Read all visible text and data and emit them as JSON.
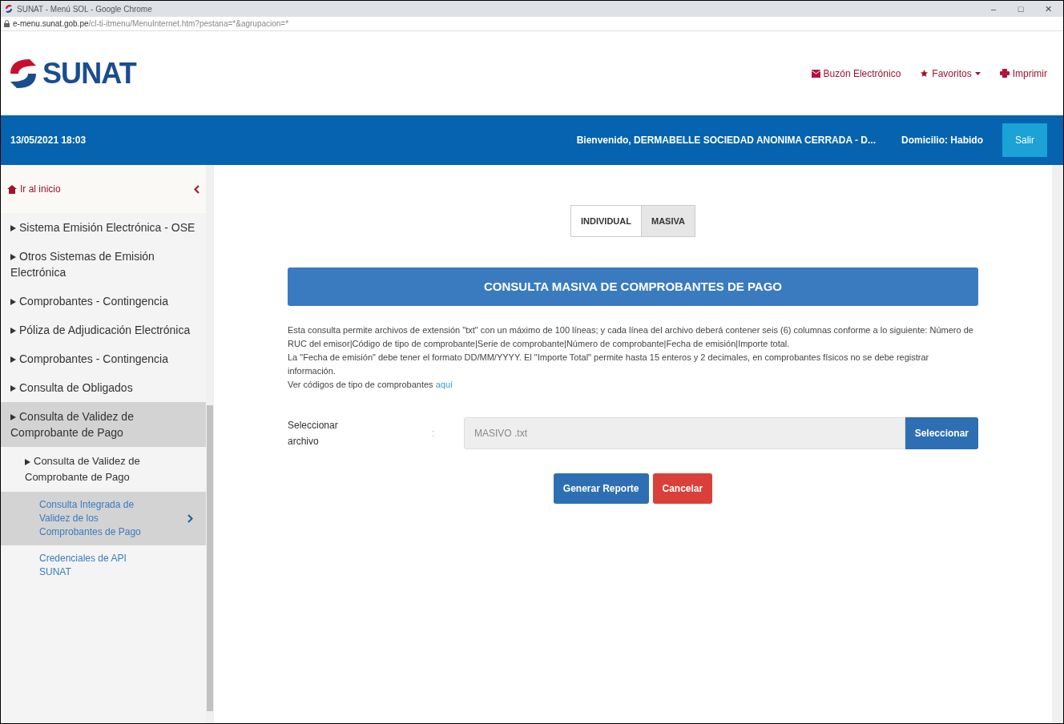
{
  "window": {
    "title": "SUNAT - Menú SOL - Google Chrome",
    "controls": [
      "–",
      "□",
      "✕"
    ]
  },
  "address_bar": {
    "domain": "e-menu.sunat.gob.pe",
    "path": "/cl-ti-itmenu/MenuInternet.htm?pestana=*&agrupacion=*"
  },
  "header": {
    "logo": "SUNAT",
    "links": [
      {
        "kind": "mail",
        "label": "Buzón Electrónico"
      },
      {
        "kind": "star",
        "label": "Favoritos",
        "dropdown": true
      },
      {
        "kind": "print",
        "label": "Imprimir"
      }
    ]
  },
  "top_bar": {
    "datetime": "13/05/2021 18:03",
    "welcome": "Bienvenido, DERMABELLE SOCIEDAD ANONIMA CERRADA - D...",
    "domicilio": "Domicilio: Habido",
    "logout": "Salir"
  },
  "sidebar": {
    "home": "Ir al inicio",
    "items": [
      {
        "kind": "section",
        "label": "Sistema Emisión Electrónica - OSE",
        "selected": false
      },
      {
        "kind": "section",
        "label": "Otros Sistemas de Emisión Electrónica",
        "selected": false
      },
      {
        "kind": "section",
        "label": "Comprobantes - Contingencia",
        "selected": false
      },
      {
        "kind": "section",
        "label": "Póliza de Adjudicación Electrónica",
        "selected": false
      },
      {
        "kind": "section",
        "label": "Comprobantes - Contingencia",
        "selected": false
      },
      {
        "kind": "section",
        "label": "Consulta de Obligados",
        "selected": false
      },
      {
        "kind": "section",
        "label": "Consulta de Validez de Comprobante de Pago",
        "selected": true
      },
      {
        "kind": "sub",
        "label": "Consulta de Validez de Comprobante de Pago",
        "selected": false
      },
      {
        "kind": "link",
        "label": "Consulta Integrada de Validez de los Comprobantes de Pago",
        "selected": true
      },
      {
        "kind": "link",
        "label": "Credenciales de API SUNAT",
        "selected": false
      }
    ]
  },
  "tabs": [
    {
      "label": "INDIVIDUAL",
      "selected": false
    },
    {
      "label": "MASIVA",
      "selected": true
    }
  ],
  "panel_title": "CONSULTA MASIVA DE COMPROBANTES DE PAGO",
  "description": [
    "Esta consulta permite archivos de extensión \"txt\" con un máximo de 100 líneas; y cada línea del archivo deberá contener seis (6) columnas conforme a lo siguiente: Número de RUC del emisor|Código de tipo de comprobante|Serie de comprobante|Número de comprobante|Fecha de emisión|Importe total.",
    "La \"Fecha de emisión\" debe tener el formato DD/MM/YYYY. El \"Importe Total\" permite hasta 15 enteros y 2 decimales, en comprobantes físicos no se debe registrar información."
  ],
  "codes_note": {
    "text": "Ver códigos de tipo de comprobantes",
    "link": "aquí"
  },
  "file_field": {
    "label": "Seleccionar archivo",
    "separator": ":",
    "value": "MASIVO .txt",
    "button": "Seleccionar"
  },
  "actions": [
    {
      "kind": "primary",
      "label": "Generar Reporte"
    },
    {
      "kind": "danger",
      "label": "Cancelar"
    }
  ]
}
